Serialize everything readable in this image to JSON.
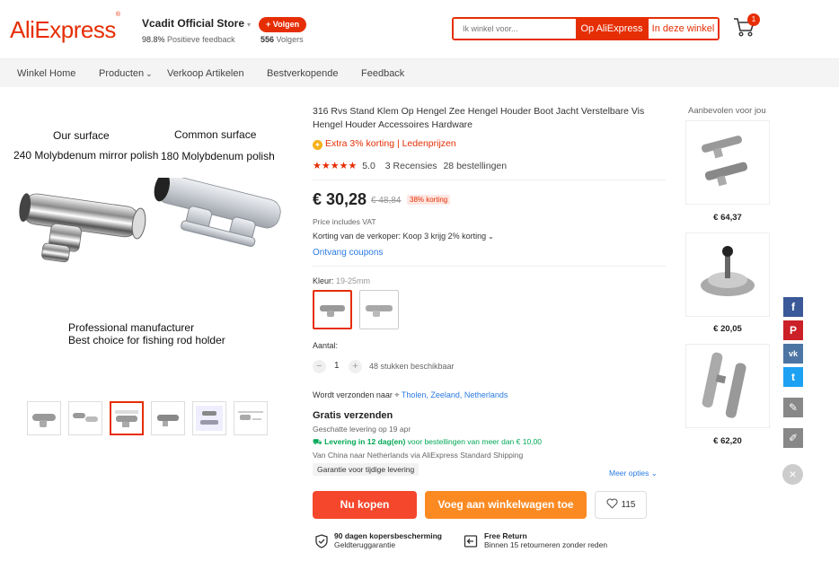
{
  "header": {
    "logo": "AliExpress",
    "store_name": "Vcadit Official Store",
    "positive_pct": "98.8%",
    "positive_label": "Positieve feedback",
    "follow_label": "+ Volgen",
    "followers_count": "556",
    "followers_label": "Volgers",
    "search_placeholder": "Ik winkel voor...",
    "search_ae_label": "Op AliExpress",
    "search_store_label": "In deze winkel",
    "cart_count": "1"
  },
  "nav": {
    "items": [
      "Winkel Home",
      "Producten",
      "Verkoop Artikelen",
      "Bestverkopende",
      "Feedback"
    ]
  },
  "gallery": {
    "our_surface": "Our surface",
    "our_spec": "240 Molybdenum  mirror polish",
    "common_surface": "Common surface",
    "common_spec": "180 Molybdenum polish",
    "tagline1": "Professional manufacturer",
    "tagline2": "Best choice for fishing rod holder"
  },
  "product": {
    "title": "316 Rvs Stand Klem Op Hengel Zee Hengel Houder Boot Jacht Verstelbare Vis Hengel Houder Accessoires Hardware",
    "extra": "Extra 3% korting | Ledenprijzen",
    "rating": "5.0",
    "reviews": "3 Recensies",
    "orders": "28 bestellingen",
    "price": "€ 30,28",
    "price_old": "€ 48,84",
    "discount": "38% korting",
    "vat": "Price includes VAT",
    "seller_discount": "Korting van de verkoper: Koop 3 krijg 2% korting",
    "coupons": "Ontvang coupons",
    "color_label": "Kleur:",
    "color_value": "19-25mm",
    "qty_label": "Aantal:",
    "qty_value": "1",
    "qty_available": "48 stukken beschikbaar",
    "ship_to_label": "Wordt verzonden naar",
    "ship_to_location": "Tholen, Zeeland, Netherlands",
    "ship_title": "Gratis verzenden",
    "ship_estimate": "Geschatte levering op 19 apr",
    "ship_delivery_bold": "Levering in 12 dag(en)",
    "ship_delivery_rest": "voor bestellingen van meer dan € 10,00",
    "ship_from": "Van China naar Netherlands via AliExpress Standard Shipping",
    "guarantee": "Garantie voor tijdige levering",
    "more_options": "Meer opties",
    "buy_label": "Nu kopen",
    "cart_label": "Voeg aan winkelwagen toe",
    "wish_count": "115",
    "protection_title": "90 dagen kopersbescherming",
    "protection_sub": "Geldteruggarantie",
    "return_title": "Free Return",
    "return_sub": "Binnen 15 retourneren zonder reden"
  },
  "recommended": {
    "title": "Aanbevolen voor jou",
    "prices": [
      "€ 64,37",
      "€ 20,05",
      "€ 62,20"
    ]
  },
  "social": {
    "icons": [
      "facebook-icon",
      "pinterest-icon",
      "vk-icon",
      "twitter-icon",
      "edit-icon",
      "pen-icon",
      "close-icon"
    ],
    "colors": {
      "facebook": "#3b5998",
      "pinterest": "#cb2027",
      "vk": "#4c75a3",
      "twitter": "#1da1f2",
      "grey": "#888888"
    }
  },
  "colors": {
    "brand": "#e62e04",
    "buy": "#f5472c",
    "cart": "#fb8a22",
    "link": "#2a7ae2",
    "green": "#00a854"
  }
}
